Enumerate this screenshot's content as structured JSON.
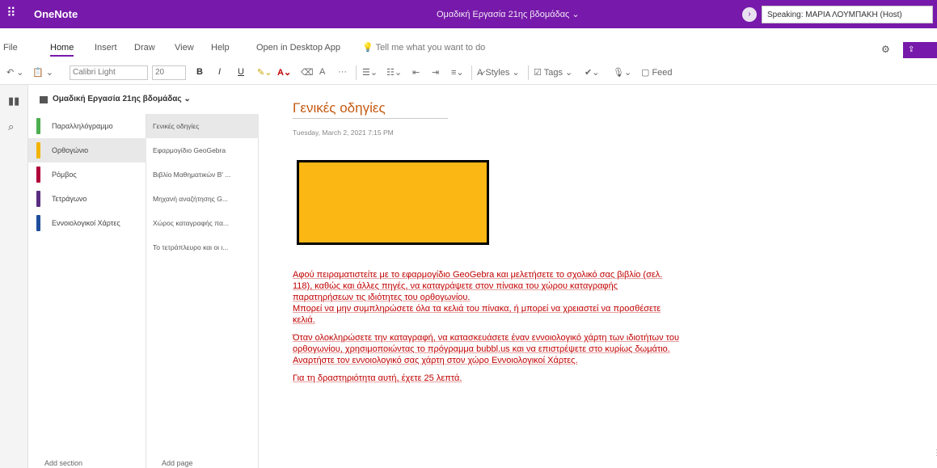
{
  "topbar": {
    "app_name": "OneNote",
    "notebook_title": "Ομαδική Εργασία 21ης βδομάδας ⌄",
    "speaking": "Speaking: ΜΑΡΙΑ ΛΟΥΜΠΑΚΗ (Host)"
  },
  "tabs": {
    "file": "File",
    "home": "Home",
    "insert": "Insert",
    "draw": "Draw",
    "view": "View",
    "help": "Help",
    "open_desktop": "Open in Desktop App",
    "tell_me": "Tell me what you want to do",
    "share": "Share"
  },
  "toolbar": {
    "font": "Calibri Light",
    "size": "20",
    "bold": "B",
    "italic": "I",
    "underline": "U",
    "styles": "Styles",
    "tags": "Tags",
    "feed": "Feed"
  },
  "notebook": {
    "name": "Ομαδική Εργασία 21ης βδομάδας ⌄"
  },
  "sections": [
    {
      "label": "Παραλληλόγραμμο",
      "color": "#4caf50"
    },
    {
      "label": "Ορθογώνιο",
      "color": "#f2b400"
    },
    {
      "label": "Ρόμβος",
      "color": "#b0003a"
    },
    {
      "label": "Τετράγωνο",
      "color": "#5a2d82"
    },
    {
      "label": "Εννοιολογικοί Χάρτες",
      "color": "#1f4e9c"
    }
  ],
  "pages": [
    {
      "label": "Γενικές οδηγίες"
    },
    {
      "label": "Εφαρμογίδιο GeoGebra"
    },
    {
      "label": "Βιβλίο Μαθηματικών Β' ..."
    },
    {
      "label": "Μηχανή αναζήτησης G..."
    },
    {
      "label": "Χώρος καταγραφής πα..."
    },
    {
      "label": "Το τετράπλευρο και οι ι..."
    }
  ],
  "footer": {
    "add_section": "Add section",
    "add_page": "Add page"
  },
  "content": {
    "title": "Γενικές οδηγίες",
    "date": "Tuesday, March 2, 2021   7:15 PM",
    "para1": "Αφού πειραματιστείτε με το εφαρμογίδιο GeoGebra και μελετήσετε το σχολικό σας βιβλίο (σελ. 118), καθώς και άλλες πηγές, να καταγράψετε στον πίνακα του χώρου καταγραφής παρατηρήσεων τις ιδιότητες του ορθογωνίου.",
    "para1b": "Μπορεί να μην συμπληρώσετε όλα τα κελιά του πίνακα, ή μπορεί να χρειαστεί να προσθέσετε κελιά.",
    "para2": "Όταν ολοκληρώσετε την καταγραφή, να κατασκευάσετε έναν εννοιολογικό χάρτη των ιδιοτήτων του ορθογωνίου, χρησιμοποιώντας το πρόγραμμα bubbl.us και να επιστρέψετε στο κυρίως δωμάτιο. Αναρτήστε τον εννοιολογικό σας χάρτη στον χώρο Εννοιολογικοί Χάρτες.",
    "para3": "Για τη δραστηριότητα αυτή, έχετε 25 λεπτά."
  },
  "colors": {
    "brand": "#7719aa",
    "yellow_box": "#fbb714",
    "body_text": "#c00000",
    "title_text": "#c55a11"
  }
}
